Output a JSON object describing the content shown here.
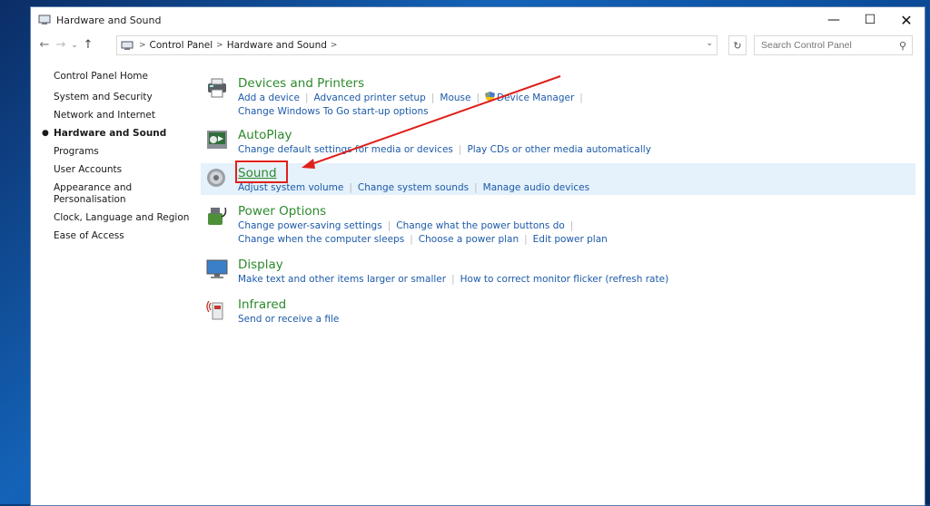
{
  "window": {
    "title": "Hardware and Sound",
    "controls": {
      "minimize": "—",
      "maximize": "☐",
      "close": "✕"
    }
  },
  "nav": {
    "back": "←",
    "forward": "→",
    "recent": "⌄",
    "up": "↑",
    "breadcrumb": [
      "Control Panel",
      "Hardware and Sound"
    ],
    "search_placeholder": "Search Control Panel"
  },
  "sidebar": {
    "home": "Control Panel Home",
    "items": [
      {
        "label": "System and Security"
      },
      {
        "label": "Network and Internet"
      },
      {
        "label": "Hardware and Sound",
        "active": true
      },
      {
        "label": "Programs"
      },
      {
        "label": "User Accounts"
      },
      {
        "label": "Appearance and\nPersonalisation"
      },
      {
        "label": "Clock, Language and Region"
      },
      {
        "label": "Ease of Access"
      }
    ]
  },
  "categories": [
    {
      "title": "Devices and Printers",
      "icon": "printer-icon",
      "lines": [
        [
          "Add a device",
          "Advanced printer setup",
          "Mouse",
          "Device Manager"
        ],
        [
          "Change Windows To Go start-up options"
        ]
      ]
    },
    {
      "title": "AutoPlay",
      "icon": "autoplay-icon",
      "lines": [
        [
          "Change default settings for media or devices",
          "Play CDs or other media automatically"
        ]
      ]
    },
    {
      "title": "Sound",
      "icon": "speaker-icon",
      "lines": [
        [
          "Adjust system volume",
          "Change system sounds",
          "Manage audio devices"
        ]
      ]
    },
    {
      "title": "Power Options",
      "icon": "power-icon",
      "lines": [
        [
          "Change power-saving settings",
          "Change what the power buttons do"
        ],
        [
          "Change when the computer sleeps",
          "Choose a power plan",
          "Edit power plan"
        ]
      ]
    },
    {
      "title": "Display",
      "icon": "monitor-icon",
      "lines": [
        [
          "Make text and other items larger or smaller",
          "How to correct monitor flicker (refresh rate)"
        ]
      ]
    },
    {
      "title": "Infrared",
      "icon": "infrared-icon",
      "lines": [
        [
          "Send or receive a file"
        ]
      ]
    }
  ],
  "colors": {
    "category_title": "#2d8a2d",
    "link": "#1c5aa8",
    "highlight": "#e5f1fb",
    "annotation": "#e0201b"
  }
}
